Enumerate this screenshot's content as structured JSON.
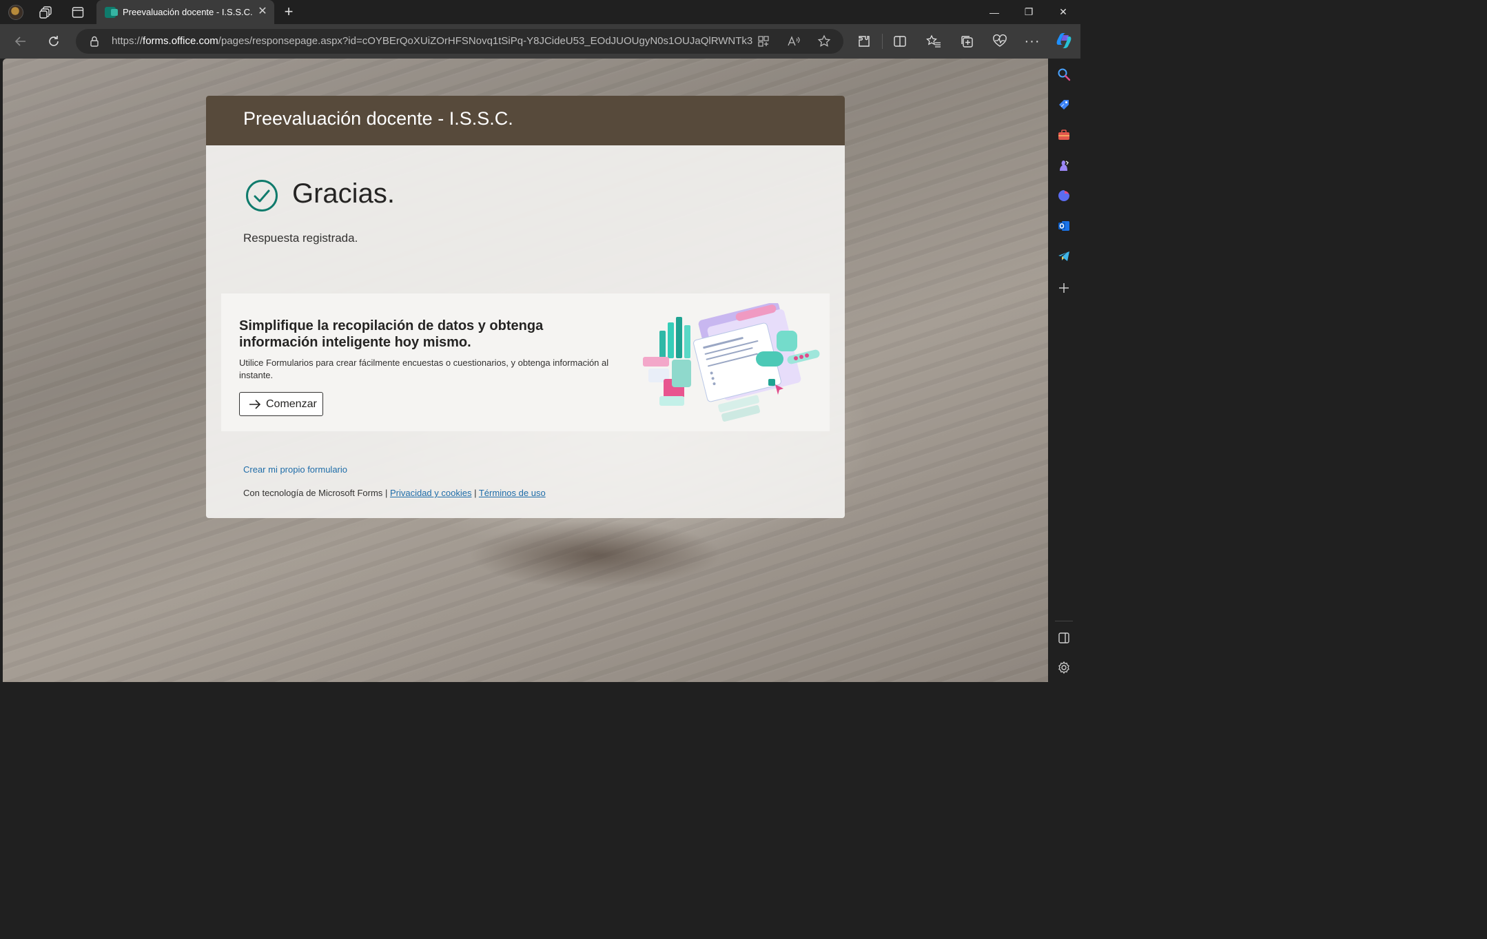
{
  "browser": {
    "tab": {
      "title": "Preevaluación docente - I.S.S.C.",
      "close_glyph": "✕"
    },
    "new_tab_glyph": "+",
    "window_controls": {
      "minimize": "—",
      "maximize": "❐",
      "close": "✕"
    },
    "address": {
      "url_prefix": "https://",
      "url_host": "forms.office.com",
      "url_path": "/pages/responsepage.aspx?id=cOYBErQoXUiZOrHFSNovq1tSiPq-Y8JCideU53_EOdJUOUgyN0s1OUJaQlRWNTk3..."
    },
    "icons": [
      "profile-avatar",
      "workspaces-icon",
      "tab-actions-icon",
      "back-arrow-icon",
      "refresh-icon",
      "lock-icon",
      "immersive-reader-icon",
      "read-aloud-icon",
      "favorite-star-icon",
      "extensions-icon",
      "split-screen-icon",
      "favorites-icon",
      "collections-icon",
      "browser-essentials-icon",
      "more-icon",
      "copilot-icon"
    ],
    "sidebar_icons": [
      "search-icon",
      "shopping-tag-icon",
      "tools-icon",
      "games-icon",
      "copilot-sidebar-icon",
      "outlook-icon",
      "telegram-icon",
      "add-icon",
      "sidebar-toggle-icon",
      "settings-icon"
    ]
  },
  "form": {
    "title": "Preevaluación docente - I.S.S.C.",
    "thanks": "Gracias.",
    "response": "Respuesta registrada.",
    "promo": {
      "heading": "Simplifique la recopilación de datos y obtenga información inteligente hoy mismo.",
      "body": "Utilice Formularios para crear fácilmente encuestas o cuestionarios, y obtenga información al instante.",
      "button": "Comenzar"
    },
    "create_link": "Crear mi propio formulario",
    "footer": {
      "powered_by": "Con tecnología de Microsoft Forms",
      "separator": "|",
      "privacy": "Privacidad y cookies",
      "terms": "Términos de uso"
    }
  },
  "colors": {
    "header_bg": "#574a3b",
    "accent_teal": "#0f7b6c",
    "link": "#1e6ca8",
    "browser_chrome": "#202020",
    "address_bar": "#3b3b3b"
  }
}
